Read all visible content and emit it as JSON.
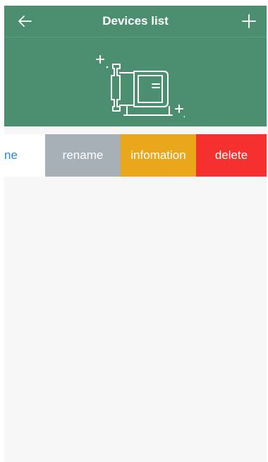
{
  "header": {
    "title": "Devices list",
    "back_icon": "arrow-left-icon",
    "add_icon": "plus-icon"
  },
  "banner": {
    "icon": "pump-icon"
  },
  "device_row": {
    "name_fragment": "ne",
    "actions": {
      "rename": "rename",
      "information": "infomation",
      "delete": "delete"
    }
  },
  "colors": {
    "header_bg": "#4b8f70",
    "rename_bg": "#a7afb7",
    "information_bg": "#eaa71c",
    "delete_bg": "#f6302e",
    "name_text": "#2e86de"
  }
}
